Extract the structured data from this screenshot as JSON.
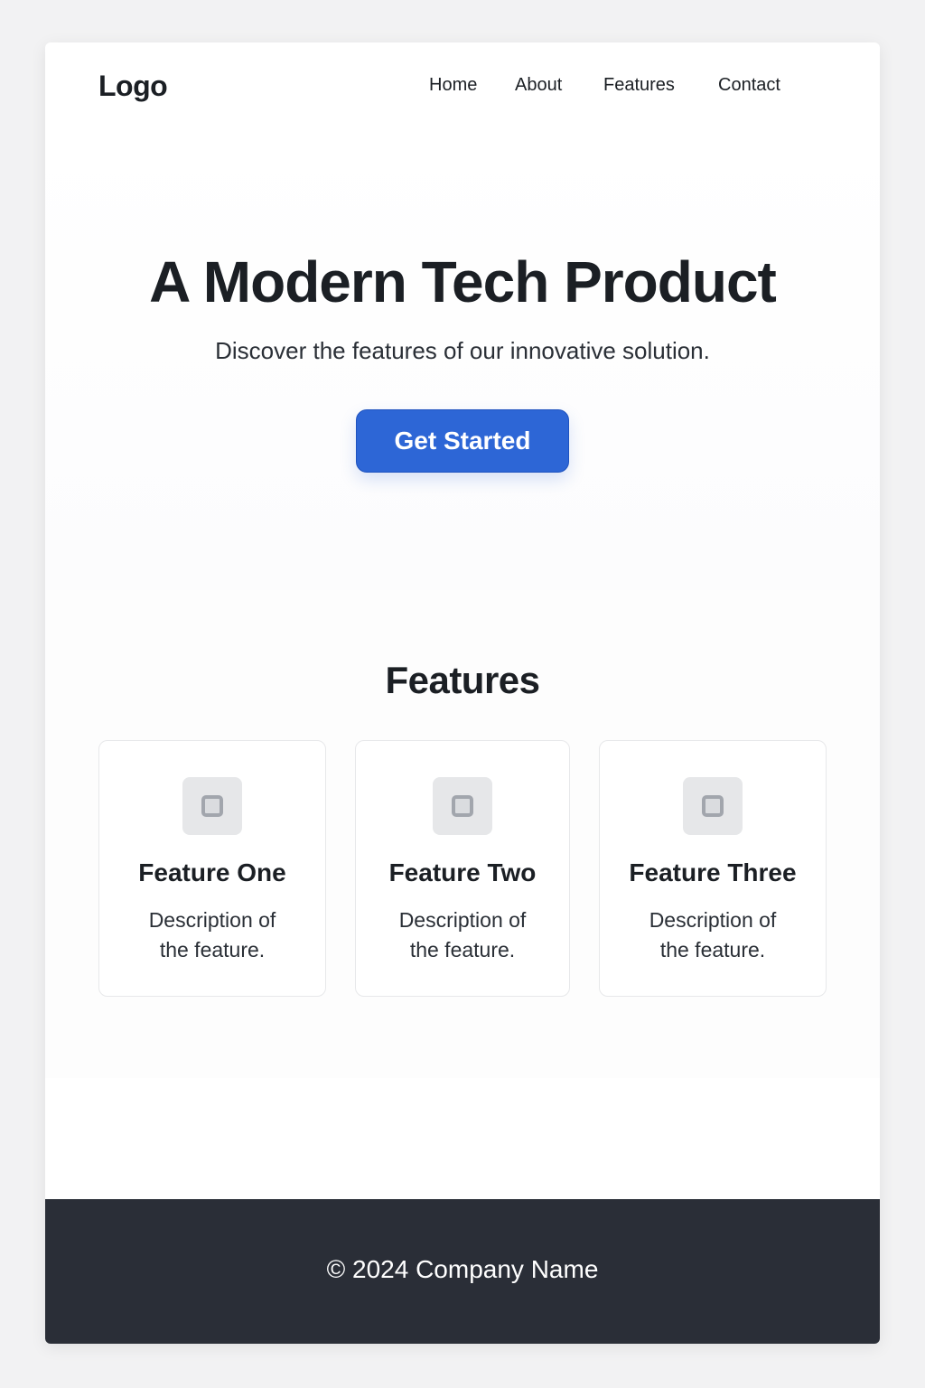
{
  "header": {
    "logo": "Logo",
    "nav": [
      "Home",
      "About",
      "Features",
      "Contact"
    ]
  },
  "hero": {
    "title": "A Modern Tech Product",
    "subtitle": "Discover the features of our innovative solution.",
    "cta_label": "Get Started",
    "cta_color": "#2d66d6"
  },
  "features": {
    "title": "Features",
    "items": [
      {
        "title": "Feature One",
        "description": "Description of the feature.",
        "icon": "square-icon"
      },
      {
        "title": "Feature Two",
        "description": "Description of the feature.",
        "icon": "square-icon"
      },
      {
        "title": "Feature Three",
        "description": "Description of the feature.",
        "icon": "square-icon"
      }
    ]
  },
  "footer": {
    "text": "© 2024 Company Name",
    "background": "#2a2e37"
  }
}
